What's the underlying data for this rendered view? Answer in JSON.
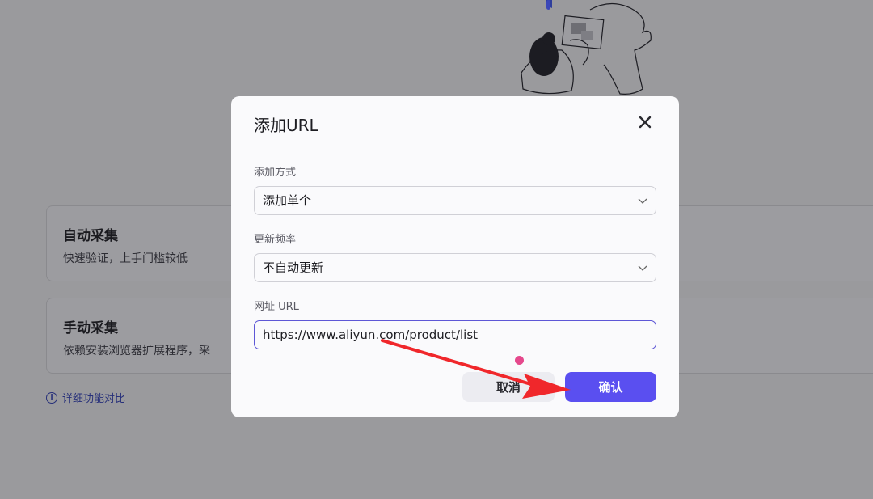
{
  "background": {
    "cards": [
      {
        "title": "自动采集",
        "desc": "快速验证，上手门槛较低"
      },
      {
        "title": "手动采集",
        "desc": "依赖安装浏览器扩展程序，采"
      }
    ],
    "compare_link": "详细功能对比"
  },
  "modal": {
    "title": "添加URL",
    "add_mode": {
      "label": "添加方式",
      "value": "添加单个"
    },
    "update_freq": {
      "label": "更新频率",
      "value": "不自动更新"
    },
    "url": {
      "label": "网址 URL",
      "value": "https://www.aliyun.com/product/list"
    },
    "cancel_label": "取消",
    "confirm_label": "确认"
  },
  "colors": {
    "accent": "#5a4ff0",
    "annotation_arrow": "#f0272b",
    "dot": "#e5488c"
  }
}
